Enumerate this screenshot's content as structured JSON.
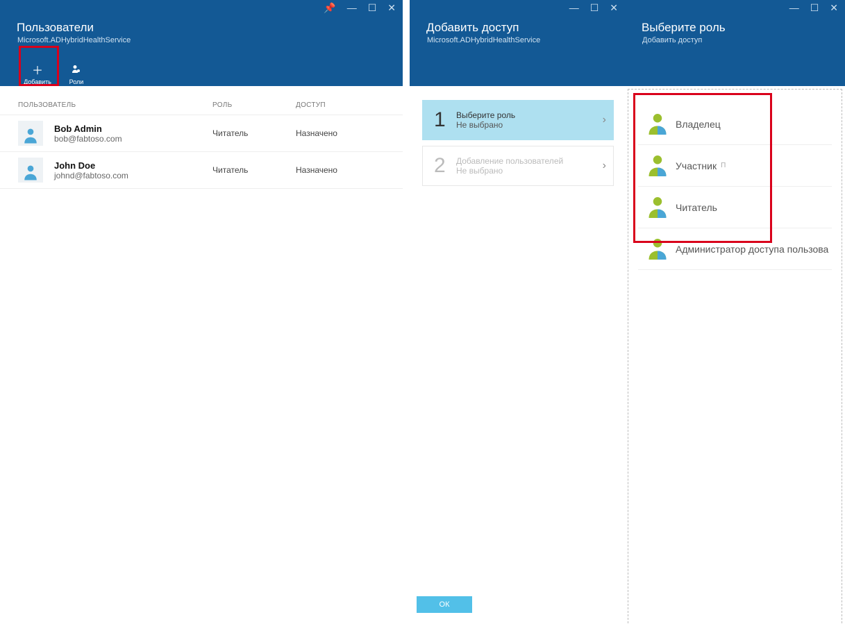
{
  "blade1": {
    "title": "Пользователи",
    "subtitle": "Microsoft.ADHybridHealthService",
    "toolbar": {
      "add": "Добавить",
      "roles": "Роли"
    },
    "columns": {
      "user": "ПОЛЬЗОВАТЕЛЬ",
      "role": "РОЛЬ",
      "access": "ДОСТУП"
    },
    "rows": [
      {
        "name": "Bob Admin",
        "email": "bob@fabtoso.com",
        "role": "Читатель",
        "access": "Назначено"
      },
      {
        "name": "John Doe",
        "email": "johnd@fabtoso.com",
        "role": "Читатель",
        "access": "Назначено"
      }
    ]
  },
  "blade2": {
    "title": "Добавить доступ",
    "subtitle": "Microsoft.ADHybridHealthService",
    "steps": [
      {
        "num": "1",
        "title": "Выберите роль",
        "sub": "Не выбрано",
        "active": true
      },
      {
        "num": "2",
        "title": "Добавление пользователей",
        "sub": "Не выбрано",
        "active": false
      }
    ],
    "ok": "ОК"
  },
  "blade3": {
    "title": "Выберите роль",
    "subtitle": "Добавить доступ",
    "roles": [
      {
        "label": "Владелец",
        "badge": ""
      },
      {
        "label": "Участник",
        "badge": "П"
      },
      {
        "label": "Читатель",
        "badge": ""
      },
      {
        "label": "Администратор доступа пользова",
        "badge": ""
      }
    ]
  }
}
